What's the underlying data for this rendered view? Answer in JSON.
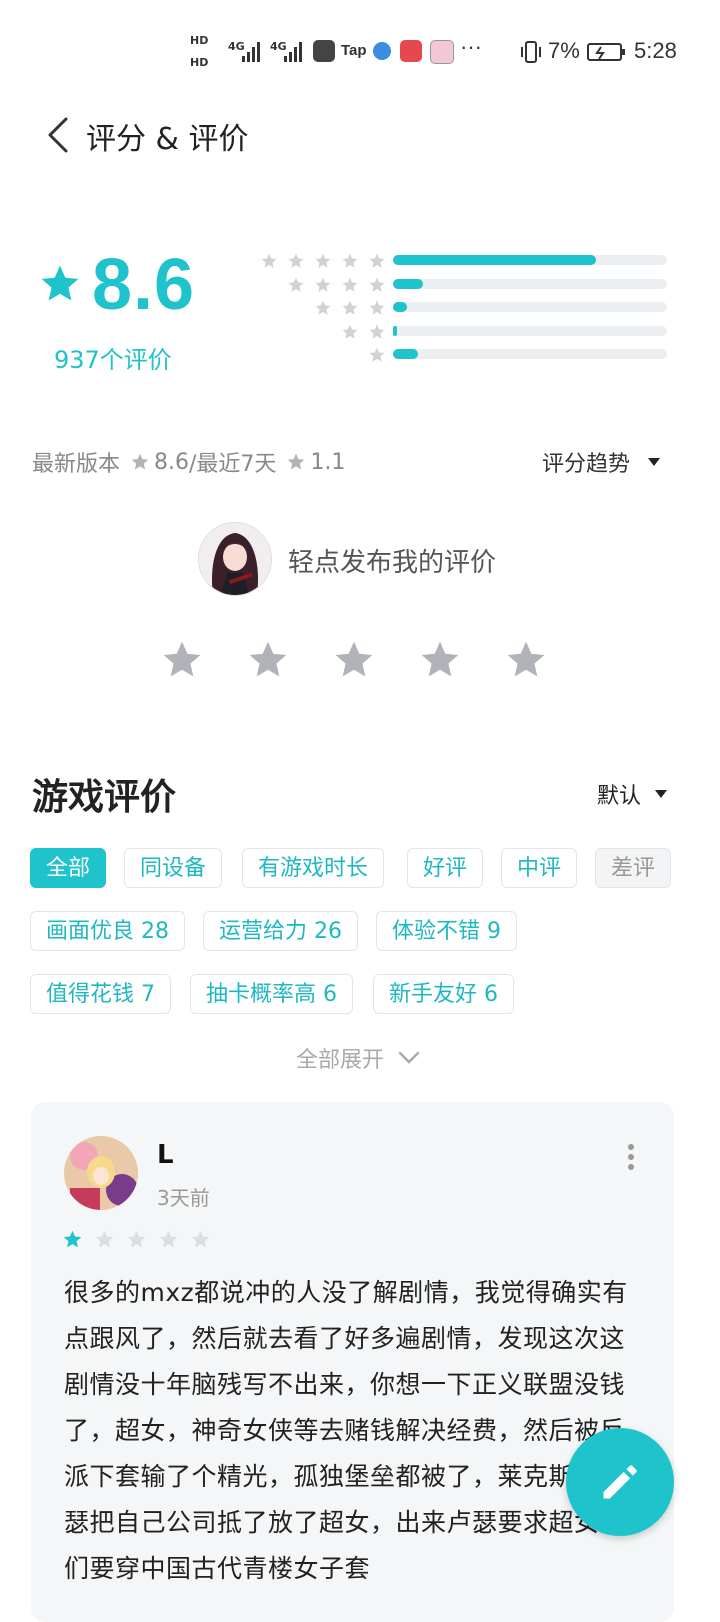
{
  "status_bar": {
    "hd1": "HD",
    "hd2": "HD",
    "net1": "4G",
    "net2": "4G",
    "tap_label": "Tap",
    "more": "···",
    "battery": "7%",
    "time": "5:28"
  },
  "header": {
    "title": "评分 & 评价"
  },
  "rating": {
    "score": "8.6",
    "count_label": "937个评价",
    "distribution": [
      {
        "stars": 5,
        "fraction": 0.74
      },
      {
        "stars": 4,
        "fraction": 0.11
      },
      {
        "stars": 3,
        "fraction": 0.05
      },
      {
        "stars": 2,
        "fraction": 0.015
      },
      {
        "stars": 1,
        "fraction": 0.09
      }
    ]
  },
  "version": {
    "latest_label": "最新版本",
    "latest_score": "8.6",
    "sep": "/最近7天",
    "recent_score": "1.1",
    "trend_label": "评分趋势"
  },
  "my_review": {
    "prompt": "轻点发布我的评价"
  },
  "reviews_section": {
    "title": "游戏评价",
    "sort_label": "默认",
    "filters": [
      "全部",
      "同设备",
      "有游戏时长",
      "好评",
      "中评",
      "差评"
    ],
    "tags": [
      "画面优良 28",
      "运营给力 26",
      "体验不错 9",
      "值得花钱 7",
      "抽卡概率高 6",
      "新手友好 6"
    ],
    "expand_label": "全部展开"
  },
  "review": {
    "user": "L",
    "time": "3天前",
    "stars": 1,
    "text": "很多的mxz都说冲的人没了解剧情，我觉得确实有点跟风了，然后就去看了好多遍剧情，发现这次这剧情没十年脑残写不出来，你想一下正义联盟没钱了，超女，神奇女侠等去赌钱解决经费，然后被反派下套输了个精光，孤独堡垒都被了，莱克斯，卢瑟把自己公司抵了放了超女，出来卢瑟要求超女她们要穿中国古代青楼女子套"
  },
  "colors": {
    "accent": "#1fc3cc",
    "track": "#eceff1",
    "star_gray": "#b0b4b8"
  }
}
